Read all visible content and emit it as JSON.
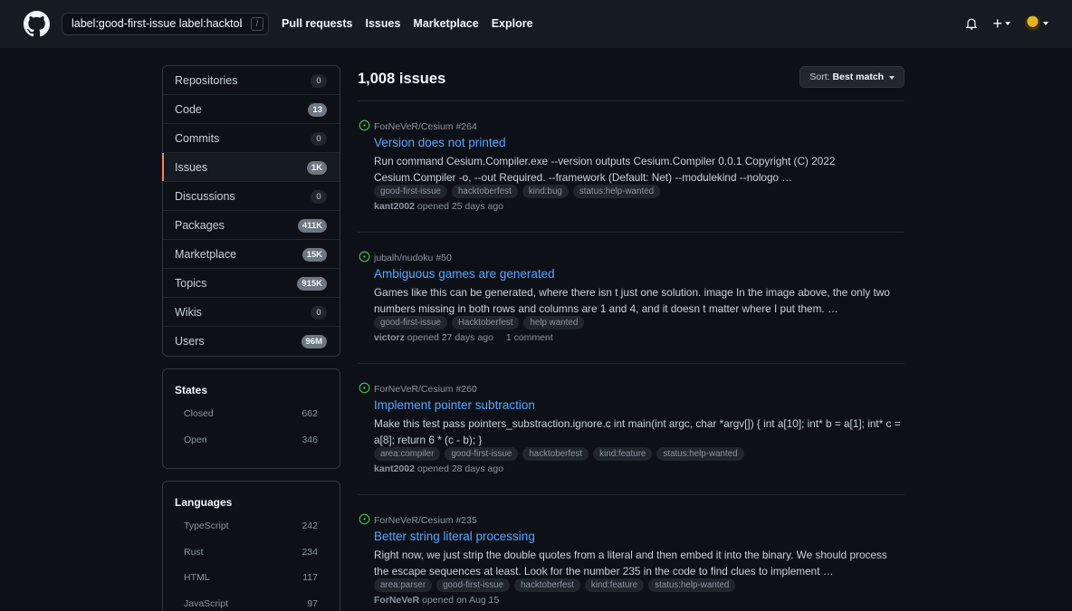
{
  "header": {
    "logo_icon": "github-mark-icon",
    "search_value": "label:good-first-issue label:hacktoberfest",
    "slash_key": "/",
    "nav": [
      "Pull requests",
      "Issues",
      "Marketplace",
      "Explore"
    ],
    "notification_icon": "bell-icon",
    "create_icon": "plus-icon",
    "create_glyph": "+"
  },
  "sidebar": {
    "categories": [
      {
        "label": "Repositories",
        "count": "0"
      },
      {
        "label": "Code",
        "count": "13"
      },
      {
        "label": "Commits",
        "count": "0"
      },
      {
        "label": "Issues",
        "count": "1K",
        "selected": true
      },
      {
        "label": "Discussions",
        "count": "0"
      },
      {
        "label": "Packages",
        "count": "411K"
      },
      {
        "label": "Marketplace",
        "count": "15K"
      },
      {
        "label": "Topics",
        "count": "915K"
      },
      {
        "label": "Wikis",
        "count": "0"
      },
      {
        "label": "Users",
        "count": "96M"
      }
    ],
    "states": {
      "title": "States",
      "items": [
        {
          "label": "Closed",
          "count": "662"
        },
        {
          "label": "Open",
          "count": "346"
        }
      ]
    },
    "languages": {
      "title": "Languages",
      "items": [
        {
          "label": "TypeScript",
          "count": "242"
        },
        {
          "label": "Rust",
          "count": "234"
        },
        {
          "label": "HTML",
          "count": "117"
        },
        {
          "label": "JavaScript",
          "count": "97"
        }
      ]
    }
  },
  "results": {
    "title": "1,008 issues",
    "sort_prefix": "Sort:",
    "sort_value": "Best match",
    "issues": [
      {
        "repo": "ForNeVeR/Cesium",
        "number": "#264",
        "title": "Version does not printed",
        "body": "Run command Cesium.Compiler.exe --version outputs Cesium.Compiler 0.0.1 Copyright (C) 2022 Cesium.Compiler -o, --out Required. --framework (Default: Net) --modulekind --nologo …",
        "labels": [
          "good-first-issue",
          "hacktoberfest",
          "kind:bug",
          "status:help-wanted"
        ],
        "author": "kant2002",
        "opened": "opened 25 days ago",
        "comments": ""
      },
      {
        "repo": "jubalh/nudoku",
        "number": "#50",
        "title": "Ambiguous games are generated",
        "body": "Games like this can be generated, where there isn t just one solution. image In the image above, the only two numbers missing in both rows and columns are 1 and 4, and it doesn t matter where I put them. …",
        "labels": [
          "good-first-issue",
          "Hacktoberfest",
          "help wanted"
        ],
        "author": "victorz",
        "opened": "opened 27 days ago",
        "comments": "1 comment"
      },
      {
        "repo": "ForNeVeR/Cesium",
        "number": "#260",
        "title": "Implement pointer subtraction",
        "body": "Make this test pass pointers_substraction.ignore.c int main(int argc, char *argv[]) { int a[10]; int* b = a[1]; int* c = a[8]; return 6 * (c - b); }",
        "labels": [
          "area:compiler",
          "good-first-issue",
          "hacktoberfest",
          "kind:feature",
          "status:help-wanted"
        ],
        "author": "kant2002",
        "opened": "opened 28 days ago",
        "comments": ""
      },
      {
        "repo": "ForNeVeR/Cesium",
        "number": "#235",
        "title": "Better string literal processing",
        "body": "Right now, we just strip the double quotes from a literal and then embed it into the binary. We should process the escape sequences at least. Look for the number 235 in the code to find clues to implement …",
        "labels": [
          "area:parser",
          "good-first-issue",
          "hacktoberfest",
          "kind:feature",
          "status:help-wanted"
        ],
        "author": "ForNeVeR",
        "opened": "opened on Aug 15",
        "comments": ""
      }
    ]
  },
  "colors": {
    "background": "#0d1117",
    "header": "#161b22",
    "link": "#58a6ff",
    "open_icon": "#3fb950",
    "selected_accent": "#f78166"
  }
}
